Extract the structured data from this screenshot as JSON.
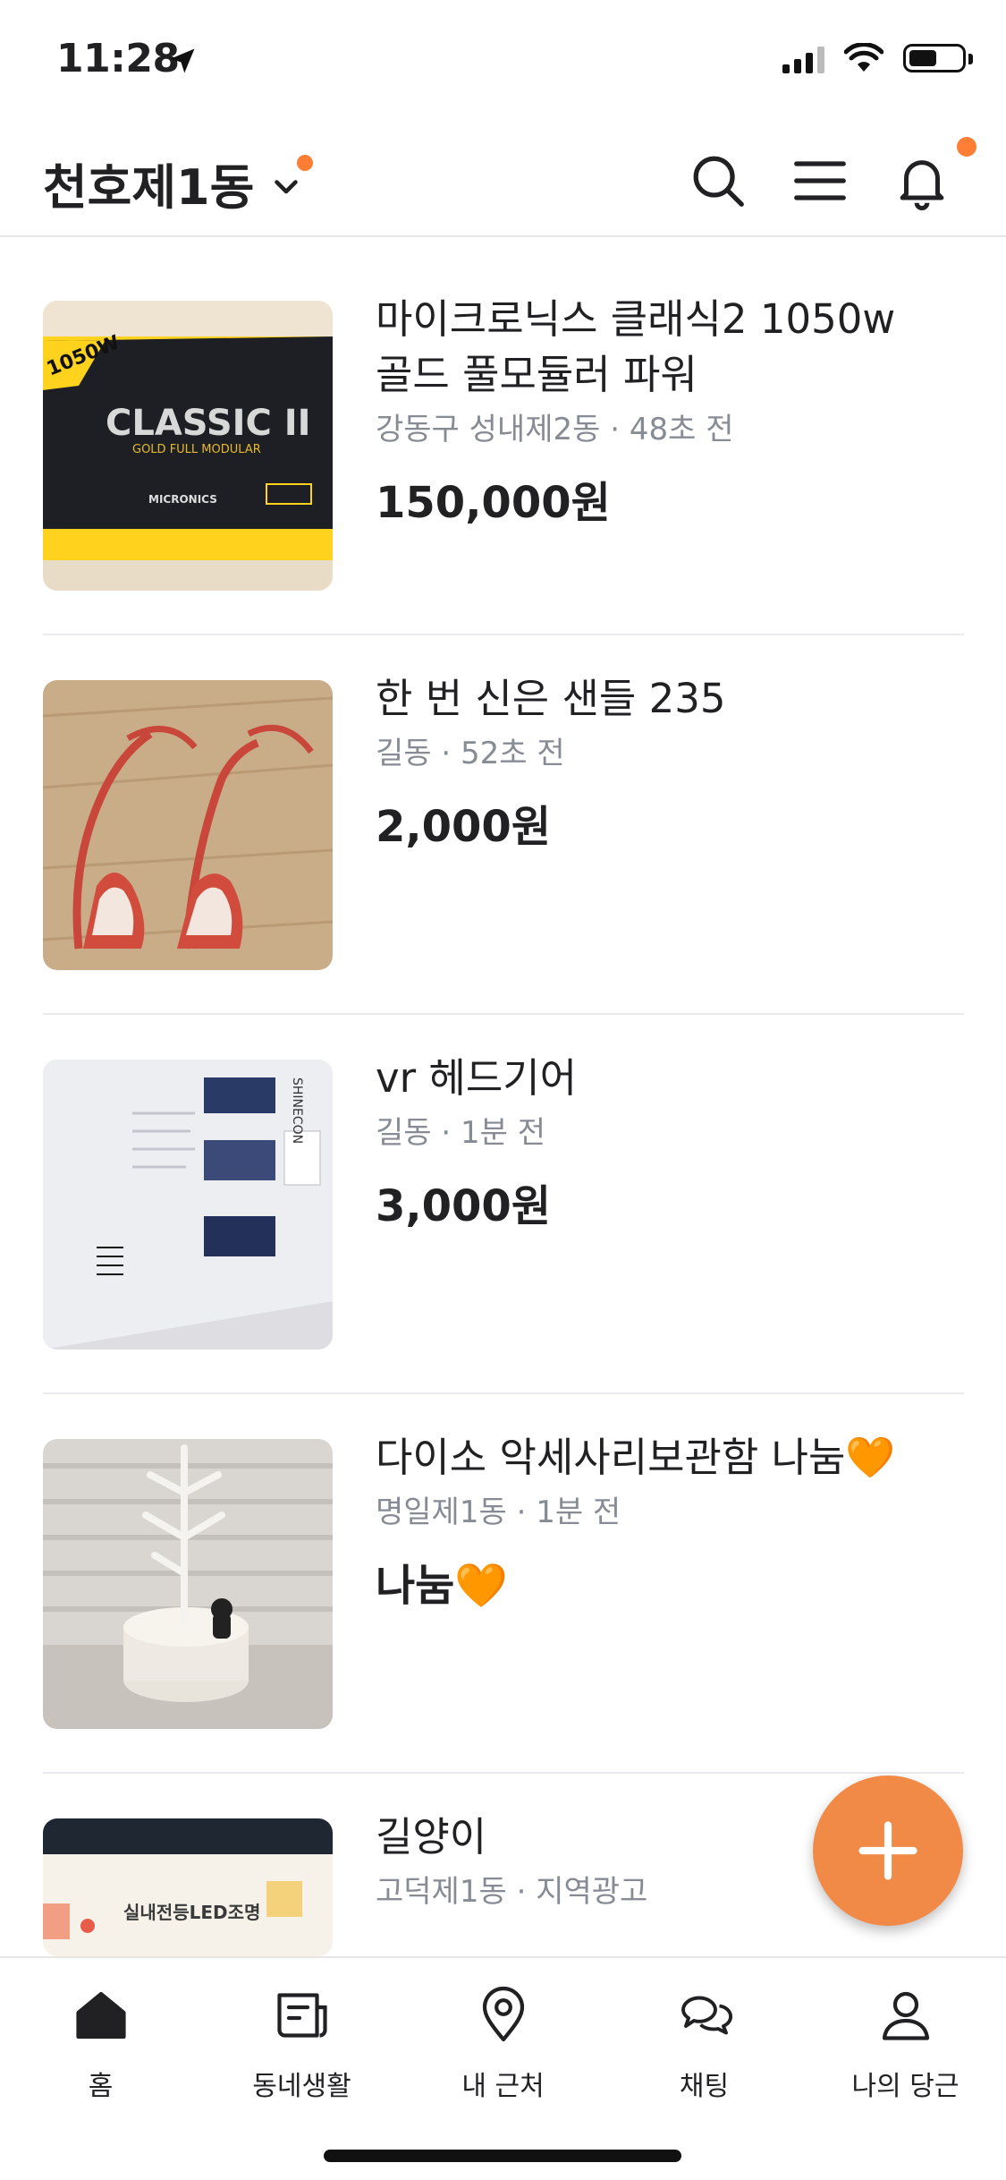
{
  "status_bar": {
    "time": "11:28"
  },
  "header": {
    "location": "천호제1동",
    "icons": [
      "search-icon",
      "menu-icon",
      "bell-icon"
    ]
  },
  "items": [
    {
      "title": "마이크로닉스 클래식2 1050w 골드 풀모듈러 파워",
      "location": "강동구 성내제2동",
      "time": "48초 전",
      "price": "150,000원"
    },
    {
      "title": "한 번 신은 샌들 235",
      "location": "길동",
      "time": "52초 전",
      "price": "2,000원"
    },
    {
      "title": "vr 헤드기어",
      "location": "길동",
      "time": "1분 전",
      "price": "3,000원"
    },
    {
      "title": "다이소 악세사리보관함 나눔🧡",
      "location": "명일제1동",
      "time": "1분 전",
      "price": "나눔🧡"
    },
    {
      "title": "길양이",
      "location": "고덕제1동",
      "time": "지역광고",
      "price": ""
    }
  ],
  "thumb_text": {
    "psu_wattage": "1050W",
    "psu_brand": "CLASSIC II",
    "psu_sub": "GOLD FULL MODULAR",
    "psu_maker": "MICRONICS",
    "vr_brand": "SHINECON",
    "ad_text": "실내전등LED조명"
  },
  "bottom_nav": {
    "items": [
      {
        "label": "홈",
        "icon": "home-icon"
      },
      {
        "label": "동네생활",
        "icon": "newspaper-icon"
      },
      {
        "label": "내 근처",
        "icon": "location-pin-icon"
      },
      {
        "label": "채팅",
        "icon": "chat-icon"
      },
      {
        "label": "나의 당근",
        "icon": "person-icon"
      }
    ]
  },
  "colors": {
    "accent": "#ff7e36",
    "fab": "#f08a46",
    "meta": "#868b94",
    "text": "#212124"
  }
}
